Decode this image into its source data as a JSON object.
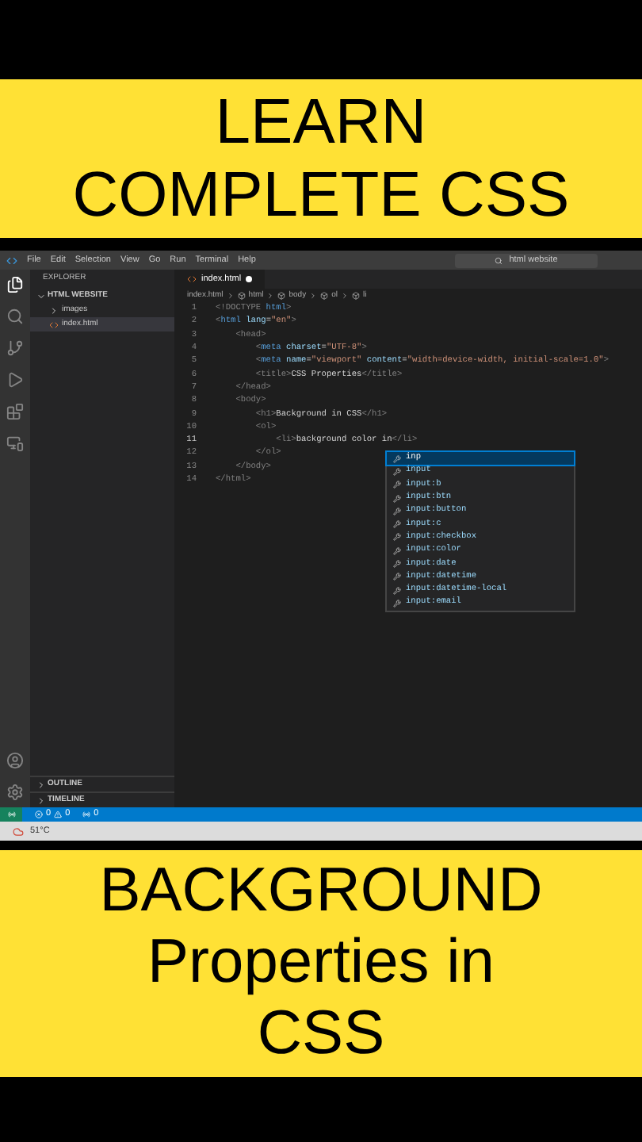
{
  "top_banner": {
    "lines": [
      "LEARN",
      "COMPLETE CSS"
    ]
  },
  "menu_bar": {
    "items": [
      "File",
      "Edit",
      "Selection",
      "View",
      "Go",
      "Run",
      "Terminal",
      "Help"
    ],
    "search": "html website"
  },
  "explorer": {
    "title": "EXPLORER",
    "folder": "HTML WEBSITE",
    "items": [
      {
        "label": "images",
        "kind": "folder",
        "selected": false
      },
      {
        "label": "index.html",
        "kind": "file",
        "selected": true
      }
    ],
    "sections": [
      "OUTLINE",
      "TIMELINE"
    ]
  },
  "editor": {
    "tab": {
      "label": "index.html",
      "modified": true
    },
    "breadcrumbs": [
      "index.html",
      "html",
      "body",
      "ol",
      "li"
    ],
    "lines": [
      {
        "number": "1",
        "tokens": [
          {
            "kind": "punct",
            "text": "<!DOCTYPE "
          },
          {
            "kind": "tag",
            "text": "html"
          },
          {
            "kind": "punct",
            "text": ">"
          }
        ]
      },
      {
        "number": "2",
        "tokens": [
          {
            "kind": "punct",
            "text": "<"
          },
          {
            "kind": "tag",
            "text": "html "
          },
          {
            "kind": "attr",
            "text": "lang"
          },
          {
            "kind": "text",
            "text": "="
          },
          {
            "kind": "str",
            "text": "\"en\""
          },
          {
            "kind": "punct",
            "text": ">"
          }
        ]
      },
      {
        "number": "3",
        "tokens": [
          {
            "kind": "punct",
            "text": "    <head>"
          }
        ]
      },
      {
        "number": "4",
        "tokens": [
          {
            "kind": "punct",
            "text": "        <"
          },
          {
            "kind": "tag",
            "text": "meta "
          },
          {
            "kind": "attr",
            "text": "charset"
          },
          {
            "kind": "text",
            "text": "="
          },
          {
            "kind": "str",
            "text": "\"UTF-8\""
          },
          {
            "kind": "punct",
            "text": ">"
          }
        ]
      },
      {
        "number": "5",
        "tokens": [
          {
            "kind": "punct",
            "text": "        <"
          },
          {
            "kind": "tag",
            "text": "meta "
          },
          {
            "kind": "attr",
            "text": "name"
          },
          {
            "kind": "text",
            "text": "="
          },
          {
            "kind": "str",
            "text": "\"viewport\" "
          },
          {
            "kind": "attr",
            "text": "content"
          },
          {
            "kind": "text",
            "text": "="
          },
          {
            "kind": "str",
            "text": "\"width=device-width, initial-scale=1.0\""
          },
          {
            "kind": "punct",
            "text": ">"
          }
        ]
      },
      {
        "number": "6",
        "tokens": [
          {
            "kind": "punct",
            "text": "        <title>"
          },
          {
            "kind": "text",
            "text": "CSS Properties"
          },
          {
            "kind": "punct",
            "text": "</title>"
          }
        ]
      },
      {
        "number": "7",
        "tokens": [
          {
            "kind": "punct",
            "text": "    </head>"
          }
        ]
      },
      {
        "number": "8",
        "tokens": [
          {
            "kind": "punct",
            "text": "    <body>"
          }
        ]
      },
      {
        "number": "9",
        "tokens": [
          {
            "kind": "punct",
            "text": "        <h1>"
          },
          {
            "kind": "text",
            "text": "Background in CSS"
          },
          {
            "kind": "punct",
            "text": "</h1>"
          }
        ]
      },
      {
        "number": "10",
        "tokens": [
          {
            "kind": "punct",
            "text": "        <ol>"
          }
        ]
      },
      {
        "number": "11",
        "current": true,
        "tokens": [
          {
            "kind": "punct",
            "text": "            <li>"
          },
          {
            "kind": "text",
            "text": "background color in"
          },
          {
            "kind": "punct",
            "text": "</li>"
          }
        ]
      },
      {
        "number": "12",
        "tokens": [
          {
            "kind": "punct",
            "text": "        </ol>"
          }
        ]
      },
      {
        "number": "13",
        "tokens": [
          {
            "kind": "punct",
            "text": "    </body>"
          }
        ]
      },
      {
        "number": "14",
        "tokens": [
          {
            "kind": "punct",
            "text": "</html>"
          }
        ]
      }
    ],
    "suggestions": [
      {
        "label": "inp",
        "selected": true
      },
      {
        "label": "input",
        "selected": false
      },
      {
        "label": "input:b",
        "selected": false
      },
      {
        "label": "input:btn",
        "selected": false
      },
      {
        "label": "input:button",
        "selected": false
      },
      {
        "label": "input:c",
        "selected": false
      },
      {
        "label": "input:checkbox",
        "selected": false
      },
      {
        "label": "input:color",
        "selected": false
      },
      {
        "label": "input:date",
        "selected": false
      },
      {
        "label": "input:datetime",
        "selected": false
      },
      {
        "label": "input:datetime-local",
        "selected": false
      },
      {
        "label": "input:email",
        "selected": false
      }
    ]
  },
  "status_bar": {
    "errors": "0",
    "warnings": "0",
    "ports": "0"
  },
  "taskbar": {
    "weather": "51°C"
  },
  "bottom_banner": {
    "lines": [
      "BACKGROUND",
      "Properties in",
      "CSS"
    ]
  }
}
